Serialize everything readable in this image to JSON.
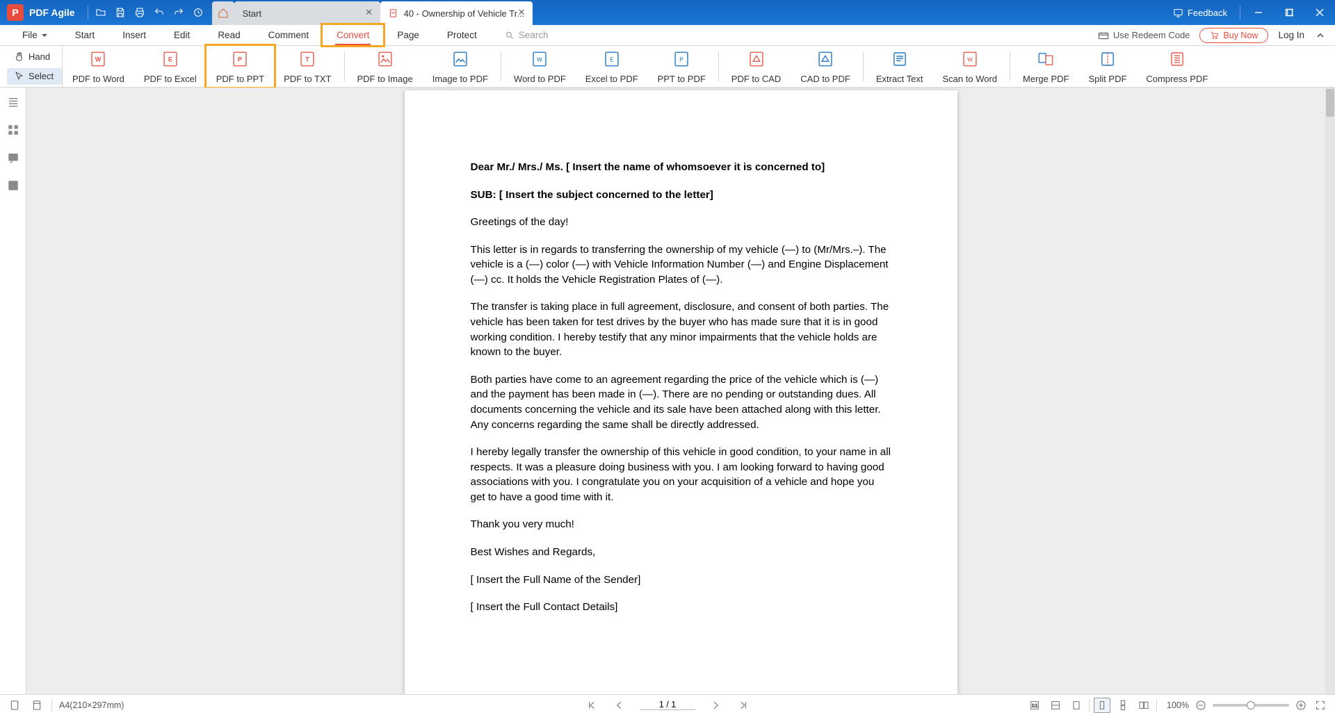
{
  "app": {
    "name": "PDF Agile"
  },
  "titlebar": {
    "feedback": "Feedback"
  },
  "tabs": {
    "start": "Start",
    "doc": "40 - Ownership of Vehicle Tr..."
  },
  "menu": {
    "file": "File",
    "start": "Start",
    "insert": "Insert",
    "edit": "Edit",
    "read": "Read",
    "comment": "Comment",
    "convert": "Convert",
    "page": "Page",
    "protect": "Protect",
    "search": "Search",
    "redeem": "Use Redeem Code",
    "buy": "Buy Now",
    "login": "Log In"
  },
  "tools": {
    "hand": "Hand",
    "select": "Select"
  },
  "ribbon": {
    "pdf_to_word": "PDF to Word",
    "pdf_to_excel": "PDF to Excel",
    "pdf_to_ppt": "PDF to PPT",
    "pdf_to_txt": "PDF to TXT",
    "pdf_to_image": "PDF to Image",
    "image_to_pdf": "Image to PDF",
    "word_to_pdf": "Word to PDF",
    "excel_to_pdf": "Excel to PDF",
    "ppt_to_pdf": "PPT to PDF",
    "pdf_to_cad": "PDF to CAD",
    "cad_to_pdf": "CAD to PDF",
    "extract_text": "Extract Text",
    "scan_to_word": "Scan to Word",
    "merge_pdf": "Merge PDF",
    "split_pdf": "Split PDF",
    "compress_pdf": "Compress PDF"
  },
  "document": {
    "p1": "Dear Mr./ Mrs./ Ms. [ Insert the name of whomsoever it is concerned to]",
    "p2": "SUB: [ Insert the subject concerned to the letter]",
    "p3": "Greetings of the day!",
    "p4": "This letter is in regards to transferring the ownership of my vehicle (—) to (Mr/Mrs.–). The vehicle is a (—) color (—) with Vehicle Information Number (—) and Engine Displacement (—) cc. It holds the Vehicle Registration Plates of (—).",
    "p5": "The transfer is taking place in full agreement, disclosure, and consent of both parties. The vehicle has been taken for test drives by the buyer who has made sure that it is in good working condition. I hereby testify that any minor impairments that the vehicle holds are known to the buyer.",
    "p6": "Both parties have come to an agreement regarding the price of the vehicle which is (—) and the payment has been made in (—). There are no pending or outstanding dues. All documents concerning the vehicle and its sale have been attached along with this letter. Any concerns regarding the same shall be directly addressed.",
    "p7": "I hereby legally transfer the ownership of this vehicle in good condition, to your name in all respects. It was a pleasure doing business with you. I am looking forward to having good associations with you. I congratulate you on your acquisition of a vehicle and hope you get to have a good time with it.",
    "p8": "Thank you very much!",
    "p9": "Best Wishes and Regards,",
    "p10": "[ Insert the Full Name of the Sender]",
    "p11": "[ Insert the Full Contact Details]"
  },
  "status": {
    "paper": "A4(210×297mm)",
    "page": "1 / 1",
    "zoom": "100%"
  }
}
